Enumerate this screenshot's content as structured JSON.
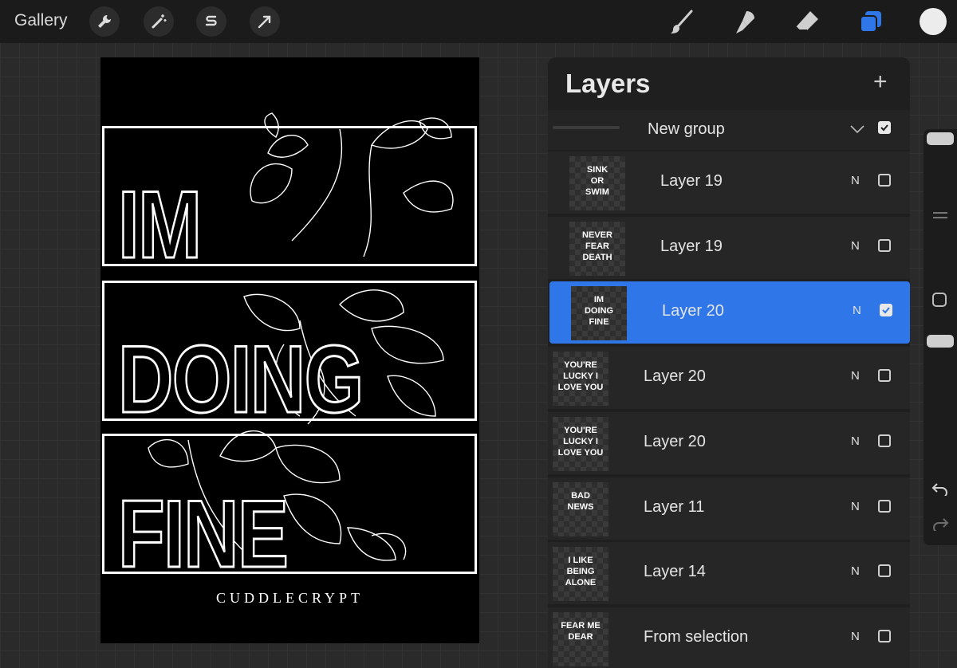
{
  "toolbar": {
    "gallery": "Gallery",
    "left_tools": [
      "wrench-icon",
      "magic-wand-icon",
      "selection-s-icon",
      "transform-arrow-icon"
    ],
    "right_tools": [
      "brush-icon",
      "smudge-icon",
      "eraser-icon",
      "layers-icon"
    ],
    "active_color": "#ececec",
    "accent": "#2f77e8"
  },
  "canvas": {
    "words": [
      "IM",
      "DOING",
      "FINE"
    ],
    "brand": "CUDDLECRYPT"
  },
  "layers_panel": {
    "title": "Layers",
    "add_icon": "+",
    "group": {
      "name": "New group",
      "checked": true
    },
    "layers": [
      {
        "name": "Layer 19",
        "blend": "N",
        "checked": false,
        "thumb": [
          "SINK",
          "OR",
          "SWIM"
        ],
        "indent": true,
        "selected": false
      },
      {
        "name": "Layer 19",
        "blend": "N",
        "checked": false,
        "thumb": [
          "NEVER",
          "FEAR",
          "DEATH"
        ],
        "indent": true,
        "selected": false
      },
      {
        "name": "Layer 20",
        "blend": "N",
        "checked": true,
        "thumb": [
          "IM",
          "DOING",
          "FINE"
        ],
        "indent": true,
        "selected": true
      },
      {
        "name": "Layer 20",
        "blend": "N",
        "checked": false,
        "thumb": [
          "YOU'RE",
          "LUCKY I",
          "LOVE YOU"
        ],
        "indent": false,
        "selected": false
      },
      {
        "name": "Layer 20",
        "blend": "N",
        "checked": false,
        "thumb": [
          "YOU'RE",
          "LUCKY I",
          "LOVE YOU"
        ],
        "indent": false,
        "selected": false
      },
      {
        "name": "Layer 11",
        "blend": "N",
        "checked": false,
        "thumb": [
          "BAD",
          "NEWS"
        ],
        "indent": false,
        "selected": false
      },
      {
        "name": "Layer 14",
        "blend": "N",
        "checked": false,
        "thumb": [
          "I LIKE",
          "BEING",
          "ALONE"
        ],
        "indent": false,
        "selected": false
      },
      {
        "name": "From selection",
        "blend": "N",
        "checked": false,
        "thumb": [
          "FEAR ME",
          "DEAR"
        ],
        "indent": false,
        "selected": false
      }
    ]
  },
  "sidebar": {
    "undo_icon": "undo-icon",
    "redo_icon": "redo-icon"
  }
}
